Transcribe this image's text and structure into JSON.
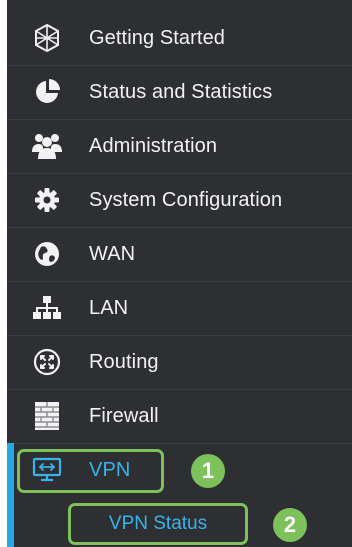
{
  "nav": {
    "items": [
      {
        "label": "Getting Started",
        "icon": "globe-wire-icon"
      },
      {
        "label": "Status and Statistics",
        "icon": "pie-chart-icon"
      },
      {
        "label": "Administration",
        "icon": "users-icon"
      },
      {
        "label": "System Configuration",
        "icon": "gear-icon"
      },
      {
        "label": "WAN",
        "icon": "globe-icon"
      },
      {
        "label": "LAN",
        "icon": "network-tree-icon"
      },
      {
        "label": "Routing",
        "icon": "routing-arrows-icon"
      },
      {
        "label": "Firewall",
        "icon": "brick-wall-icon"
      },
      {
        "label": "VPN",
        "icon": "monitor-arrows-icon"
      }
    ],
    "sub_items": [
      {
        "label": "VPN Status"
      }
    ]
  },
  "callouts": {
    "first": "1",
    "second": "2"
  },
  "colors": {
    "panel_bg": "#2d2f33",
    "text": "#f2f2f2",
    "active_text": "#39b3ea",
    "active_bar": "#26a9e0",
    "callout": "#7cc15a"
  }
}
